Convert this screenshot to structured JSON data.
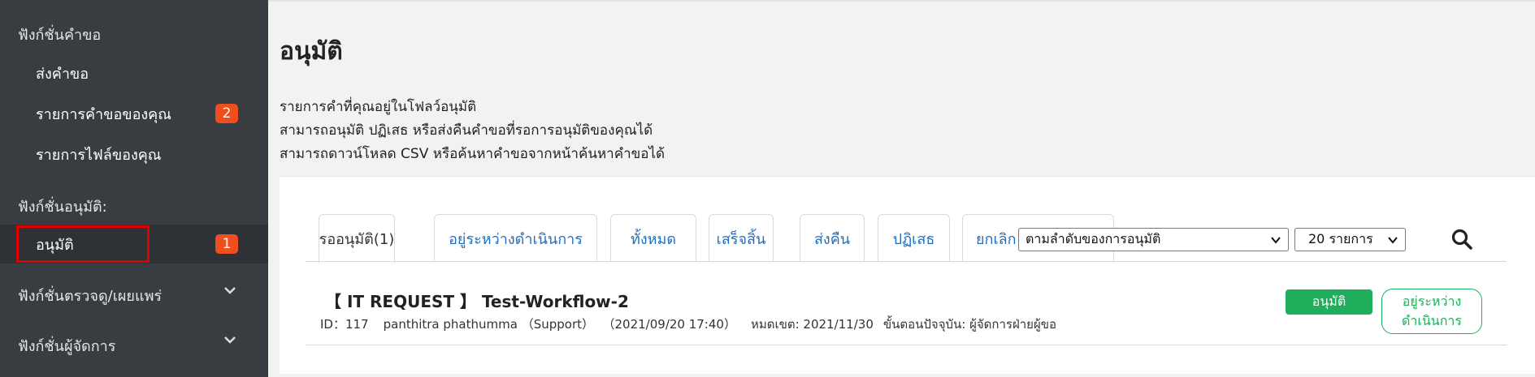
{
  "sidebar": {
    "sections": [
      {
        "title": "ฟังก์ชั่นคำขอ"
      },
      {
        "title": "ฟังก์ชั่นอนุมัติ:"
      },
      {
        "title": "ฟังก์ชั่นตรวจดู/เผยแพร่"
      },
      {
        "title": "ฟังก์ชั่นผู้จัดการ"
      }
    ],
    "items": [
      {
        "label": "ส่งคำขอ"
      },
      {
        "label": "รายการคำขอของคุณ",
        "badge": "2"
      },
      {
        "label": "รายการไฟล์ของคุณ"
      },
      {
        "label": "อนุมัติ",
        "badge": "1"
      }
    ]
  },
  "main": {
    "title": "อนุมัติ",
    "description": [
      "รายการคำที่คุณอยู่ในโฟลว์อนุมัติ",
      "สามารถอนุมัติ ปฏิเสธ หรือส่งคืนคำขอที่รอการอนุมัติของคุณได้",
      "สามารถดาวน์โหลด CSV หรือค้นหาคำขอจากหน้าค้นหาคำขอได้"
    ],
    "tabs": [
      {
        "label": "รออนุมัติ(1)"
      },
      {
        "label": "อยู่ระหว่างดำเนินการ"
      },
      {
        "label": "ทั้งหมด"
      },
      {
        "label": "เสร็จสิ้น"
      },
      {
        "label": "ส่งคืน"
      },
      {
        "label": "ปฏิเสธ"
      },
      {
        "label": "ยกเลิก"
      }
    ],
    "sort_select": {
      "value": "ตามลำดับของการอนุมัติ"
    },
    "count_select": {
      "value": "20 รายการ"
    },
    "request": {
      "title": "【 IT REQUEST 】 Test-Workflow-2",
      "id": "ID：117",
      "user": "panthitra phathumma （Support）",
      "date": "（2021/09/20 17:40）",
      "deadline": "หมดเขต: 2021/11/30",
      "current_step": "ขั้นตอนปัจจุบัน: ผู้จัดการฝ่ายผู้ขอ",
      "approve_label": "อนุมัติ",
      "status_line1": "อยู่ระหว่าง",
      "status_line2": "ดำเนินการ"
    }
  },
  "colors": {
    "sidebar_bg": "#393c40",
    "badge": "#f04e1c",
    "link_blue": "#1f6fbf",
    "approve_green": "#1fae5b",
    "highlight_red": "#e00000"
  },
  "icons": [
    "chevron-down-icon",
    "search-icon"
  ]
}
